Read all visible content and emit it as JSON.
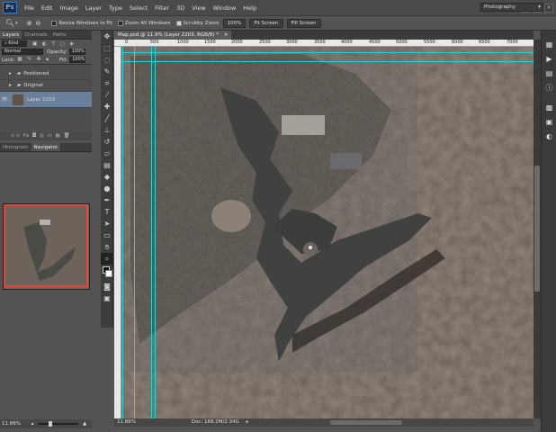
{
  "menubar": {
    "logo": "Ps",
    "items": [
      "File",
      "Edit",
      "Image",
      "Layer",
      "Type",
      "Select",
      "Filter",
      "3D",
      "View",
      "Window",
      "Help"
    ],
    "win_controls": [
      "–",
      "□",
      "×"
    ]
  },
  "options": {
    "resize_windows": "Resize Windows to Fit",
    "zoom_all": "Zoom All Windows",
    "scrubby_zoom": "Scrubby Zoom",
    "btn_100": "100%",
    "btn_fit": "Fit Screen",
    "btn_fill": "Fill Screen",
    "workspace": "Photography"
  },
  "layers_panel": {
    "tabs": [
      "Layers",
      "Channels",
      "Paths"
    ],
    "kind": "Kind",
    "blend_mode": "Normal",
    "opacity_label": "Opacity:",
    "opacity_value": "100%",
    "lock_label": "Lock:",
    "fill_label": "Fill:",
    "fill_value": "100%",
    "layers": [
      {
        "name": "Positioned",
        "type": "folder"
      },
      {
        "name": "Original",
        "type": "folder"
      },
      {
        "name": "Layer 2203",
        "type": "image",
        "selected": true
      }
    ],
    "footer_icons": "⊂⊃ fx ◘ ◎ ▭ ▤ 🗑"
  },
  "nav_panel": {
    "tabs": [
      "Histogram",
      "Navigator"
    ],
    "zoom": "11.86%"
  },
  "document": {
    "tab_title": "Map.psd @ 11.9% (Layer 2203, RGB/8) *",
    "ruler_ticks": [
      "0",
      "500",
      "1000",
      "1500",
      "2000",
      "2500",
      "3000",
      "3500",
      "4000",
      "4500",
      "5000",
      "5500",
      "6000",
      "6500",
      "7000"
    ],
    "zoom": "11.86%",
    "doc_size": "Doc: 168.2M/2.34G"
  },
  "toolbar_icons": [
    "move",
    "marquee",
    "lasso",
    "quick-select",
    "crop",
    "eyedropper",
    "heal",
    "brush",
    "stamp",
    "history-brush",
    "eraser",
    "gradient",
    "blur",
    "dodge",
    "pen",
    "type",
    "path-select",
    "rectangle",
    "hand",
    "zoom",
    "fg-bg-colors",
    "quick-mask",
    "screen-mode"
  ],
  "dock_icons": [
    "history",
    "actions",
    "properties",
    "info",
    "swatches",
    "styles",
    "adjustments"
  ],
  "colors": {
    "water": "#3f423f",
    "terrain": "#6a5f56",
    "guide": "#27d3d3",
    "nav_frame": "#e0453e"
  }
}
